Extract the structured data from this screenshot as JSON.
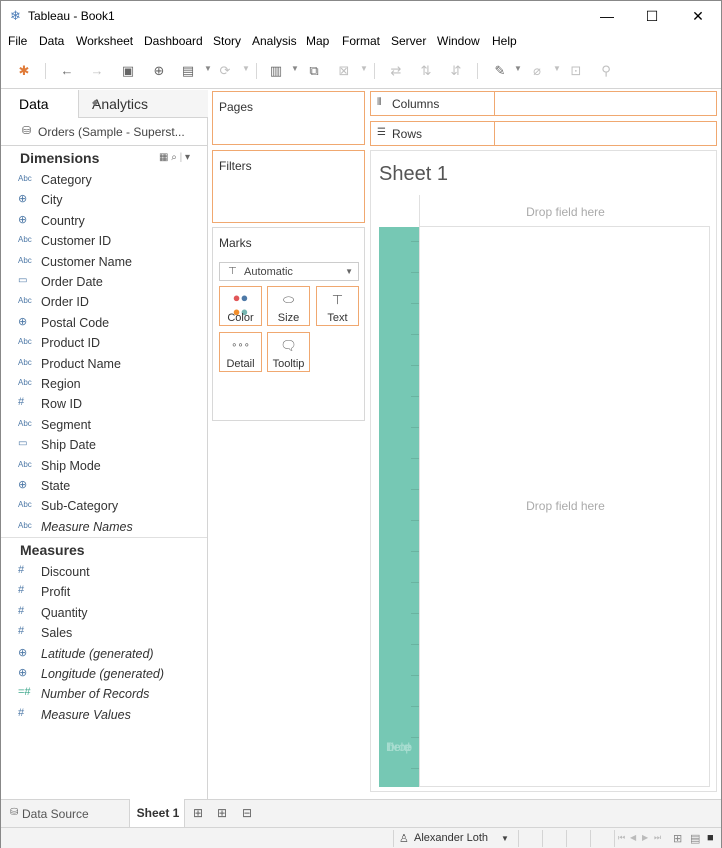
{
  "window": {
    "title": "Tableau - Book1",
    "minimize": "—",
    "maximize": "☐",
    "close": "✕"
  },
  "menu": [
    "File",
    "Data",
    "Worksheet",
    "Dashboard",
    "Story",
    "Analysis",
    "Map",
    "Format",
    "Server",
    "Window",
    "Help"
  ],
  "left_pane": {
    "tabs": {
      "data": "Data",
      "analytics": "Analytics"
    },
    "datasource": "Orders (Sample - Superst...",
    "dimensions_header": "Dimensions",
    "dimensions": [
      {
        "type": "Abc",
        "label": "Category",
        "italic": false
      },
      {
        "type": "geo",
        "label": "City",
        "italic": false
      },
      {
        "type": "geo",
        "label": "Country",
        "italic": false
      },
      {
        "type": "Abc",
        "label": "Customer ID",
        "italic": false
      },
      {
        "type": "Abc",
        "label": "Customer Name",
        "italic": false
      },
      {
        "type": "date",
        "label": "Order Date",
        "italic": false
      },
      {
        "type": "Abc",
        "label": "Order ID",
        "italic": false
      },
      {
        "type": "geo",
        "label": "Postal Code",
        "italic": false
      },
      {
        "type": "Abc",
        "label": "Product ID",
        "italic": false
      },
      {
        "type": "Abc",
        "label": "Product Name",
        "italic": false
      },
      {
        "type": "Abc",
        "label": "Region",
        "italic": false
      },
      {
        "type": "num",
        "label": "Row ID",
        "italic": false
      },
      {
        "type": "Abc",
        "label": "Segment",
        "italic": false
      },
      {
        "type": "date",
        "label": "Ship Date",
        "italic": false
      },
      {
        "type": "Abc",
        "label": "Ship Mode",
        "italic": false
      },
      {
        "type": "geo",
        "label": "State",
        "italic": false
      },
      {
        "type": "Abc",
        "label": "Sub-Category",
        "italic": false
      },
      {
        "type": "Abc",
        "label": "Measure Names",
        "italic": true
      }
    ],
    "measures_header": "Measures",
    "measures": [
      {
        "type": "num",
        "label": "Discount",
        "italic": false
      },
      {
        "type": "num",
        "label": "Profit",
        "italic": false
      },
      {
        "type": "num",
        "label": "Quantity",
        "italic": false
      },
      {
        "type": "num",
        "label": "Sales",
        "italic": false
      },
      {
        "type": "geo",
        "label": "Latitude (generated)",
        "italic": true
      },
      {
        "type": "geo",
        "label": "Longitude (generated)",
        "italic": true
      },
      {
        "type": "numcalc",
        "label": "Number of Records",
        "italic": true
      },
      {
        "type": "num",
        "label": "Measure Values",
        "italic": true
      }
    ]
  },
  "cards": {
    "pages": "Pages",
    "filters": "Filters",
    "marks": "Marks",
    "mark_type": "Automatic",
    "mark_buttons": [
      "Color",
      "Size",
      "Text",
      "Detail",
      "Tooltip"
    ]
  },
  "shelves": {
    "columns": "Columns",
    "rows": "Rows"
  },
  "view": {
    "sheet_title": "Sheet 1",
    "drop_columns": "Drop field here",
    "drop_rows_lines": [
      "Drop",
      "field",
      "here"
    ],
    "drop_body": "Drop field here"
  },
  "bottom_tabs": {
    "data_source": "Data Source",
    "sheet": "Sheet 1"
  },
  "status": {
    "user": "Alexander Loth"
  },
  "colors": {
    "accent_border": "#f0a870",
    "row_drop": "#76c8b4",
    "field_dim": "#4e79a7",
    "field_measure": "#3aa68a"
  }
}
